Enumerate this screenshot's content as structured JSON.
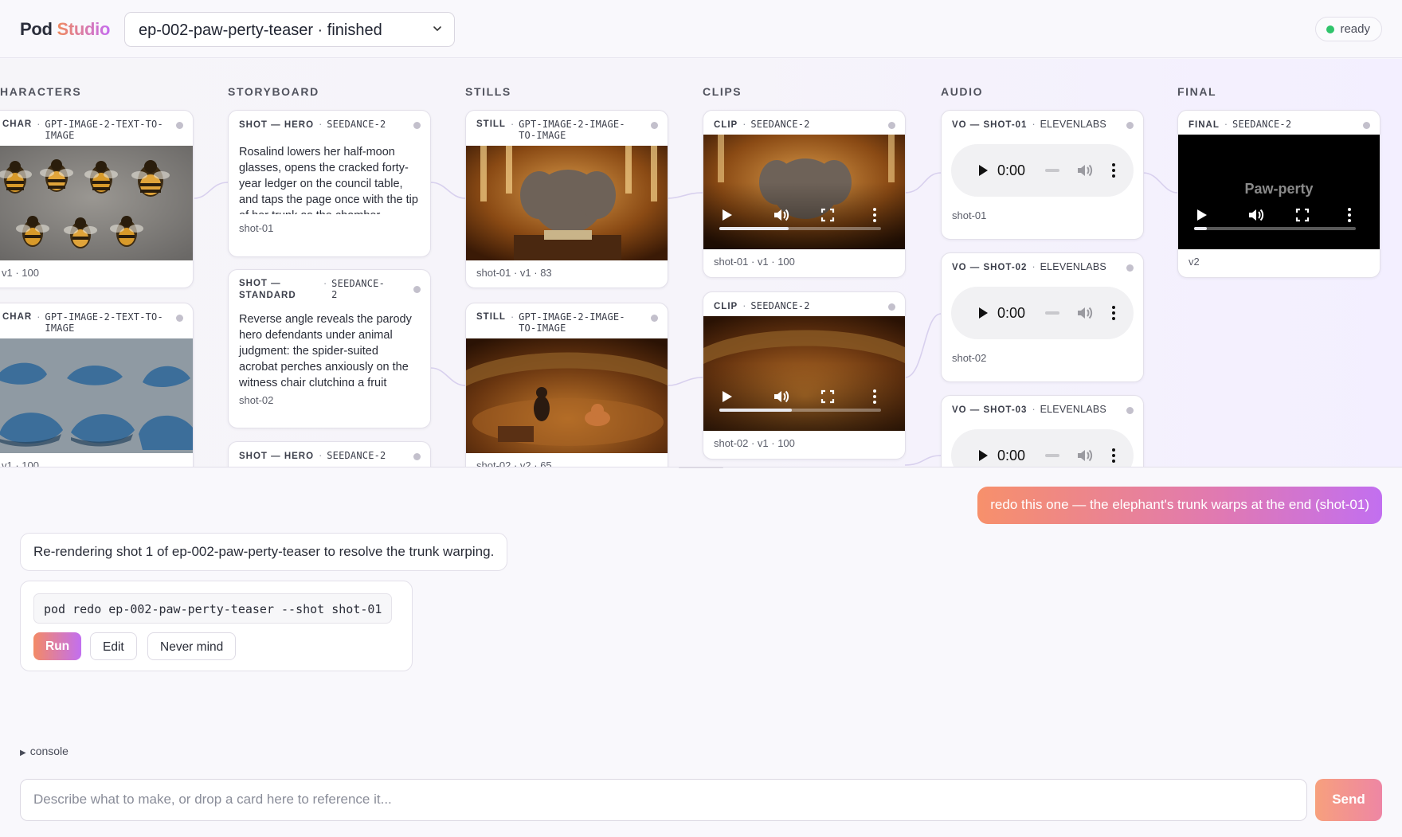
{
  "app": {
    "brand_bold": "Pod",
    "brand_accent": "Studio",
    "accent_colors": [
      "#f08a5d",
      "#c56cf0"
    ]
  },
  "header": {
    "episode_select": "ep-002-paw-perty-teaser · finished",
    "status": "ready",
    "status_color": "#2fc46b"
  },
  "board": {
    "columns": {
      "characters": "HARACTERS",
      "storyboard": "STORYBOARD",
      "stills": "STILLS",
      "clips": "CLIPS",
      "audio": "AUDIO",
      "final": "FINAL"
    },
    "characters": [
      {
        "kind": "CHAR",
        "model": "GPT-IMAGE-2-TEXT-TO-IMAGE",
        "model_line1": "GPT-IMAGE-2-TEXT-TO-",
        "model_line2": "IMAGE",
        "footer": "v1 · 100",
        "image": "bee-character-sheet"
      },
      {
        "kind": "CHAR",
        "model": "GPT-IMAGE-2-TEXT-TO-IMAGE",
        "model_line1": "GPT-IMAGE-2-TEXT-TO-",
        "model_line2": "IMAGE",
        "footer": "v1 · 100",
        "image": "whale-character-sheet"
      }
    ],
    "storyboard": [
      {
        "kind": "SHOT — HERO",
        "model": "SEEDANCE-2",
        "text": "Rosalind lowers her half-moon glasses, opens the cracked forty-year ledger on the council table, and taps the page once with the tip of her trunk as the chamber",
        "footer": "shot-01"
      },
      {
        "kind_line1": "SHOT —",
        "kind_line2": "STANDARD",
        "model_line1": "SEEDANCE-",
        "model_line2": "2",
        "text": "Reverse angle reveals the parody hero defendants under animal judgment: the spider-suited acrobat perches anxiously on the witness chair clutching a fruit",
        "footer": "shot-02"
      },
      {
        "kind": "SHOT — HERO",
        "model": "SEEDANCE-2"
      }
    ],
    "stills": [
      {
        "kind": "STILL",
        "model_line1": "GPT-IMAGE-2-IMAGE-",
        "model_line2": "TO-IMAGE",
        "footer": "shot-01 · v1 · 83",
        "image": "elephant-council-still"
      },
      {
        "kind": "STILL",
        "model_line1": "GPT-IMAGE-2-IMAGE-",
        "model_line2": "TO-IMAGE",
        "footer": "shot-02 · v2 · 65",
        "image": "courtroom-still"
      }
    ],
    "clips": [
      {
        "kind": "CLIP",
        "model": "SEEDANCE-2",
        "footer": "shot-01 · v1 · 100",
        "progress": 0.43
      },
      {
        "kind": "CLIP",
        "model": "SEEDANCE-2",
        "footer": "shot-02 · v1 · 100",
        "progress": 0.45
      }
    ],
    "audio": [
      {
        "kind": "VO — SHOT-01",
        "model": "ELEVENLABS",
        "time": "0:00",
        "footer": "shot-01"
      },
      {
        "kind": "VO — SHOT-02",
        "model": "ELEVENLABS",
        "time": "0:00",
        "footer": "shot-02"
      },
      {
        "kind": "VO — SHOT-03",
        "model": "ELEVENLABS",
        "time": "0:00"
      }
    ],
    "final": [
      {
        "kind": "FINAL",
        "model": "SEEDANCE-2",
        "overlay_title": "Paw-perty",
        "footer": "v2",
        "progress": 0.08
      }
    ]
  },
  "chat": {
    "user_message": "redo this one — the elephant's trunk warps at the end (shot-01)",
    "assistant_message": "Re-rendering shot 1 of ep-002-paw-perty-teaser to resolve the trunk warping.",
    "command": "pod redo ep-002-paw-perty-teaser --shot shot-01",
    "buttons": {
      "run": "Run",
      "edit": "Edit",
      "never_mind": "Never mind"
    },
    "console_label": "console",
    "prompt_placeholder": "Describe what to make, or drop a card here to reference it...",
    "send_label": "Send"
  },
  "icons": [
    "chevron-down-icon",
    "status-dot-icon",
    "play-icon",
    "volume-icon",
    "fullscreen-icon",
    "more-icon",
    "console-toggle-icon"
  ]
}
